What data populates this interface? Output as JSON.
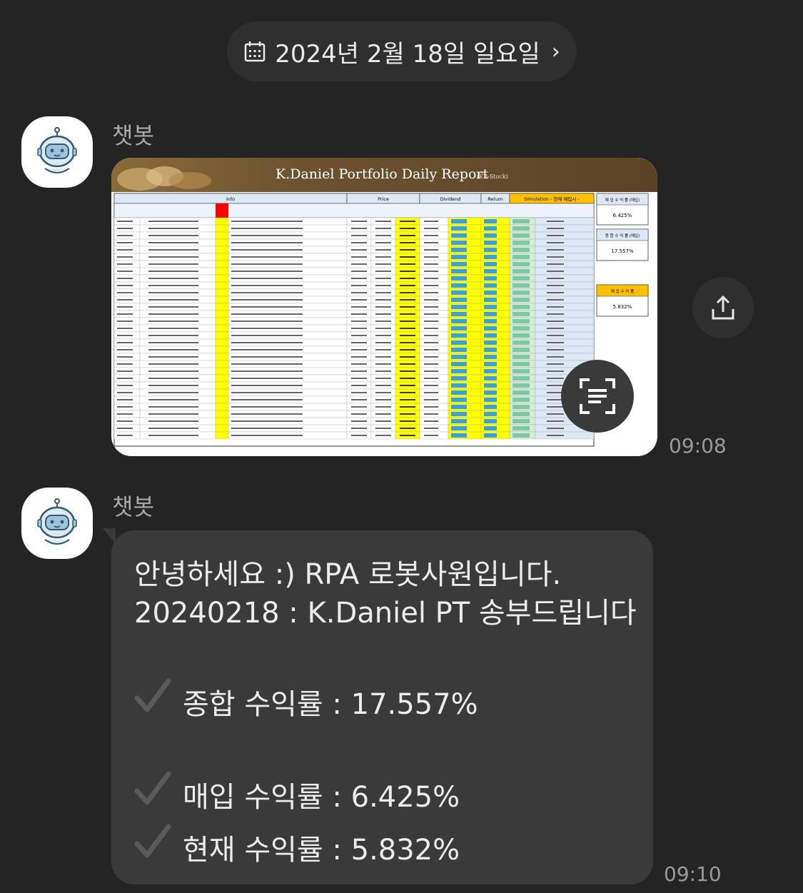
{
  "date_header": {
    "label": "2024년 2월 18일 일요일",
    "chevron": "›",
    "icon": "calendar-icon"
  },
  "messages": [
    {
      "sender": "챗봇",
      "type": "image",
      "time": "09:08",
      "report": {
        "title": "K.Daniel Portfolio Daily Report",
        "subtitle": "(KR-Stock)",
        "sections": [
          "Info",
          "Price",
          "Dividend",
          "Return",
          "Simulation - 현재 매입시 -"
        ],
        "summary_boxes": [
          {
            "label": "매 입 수 익 률 (매입)",
            "value": "6.425%"
          },
          {
            "label": "종 합 수 익 률 (매입)",
            "value": "17.557%"
          },
          {
            "label": "매 입 수 익 률",
            "value": "5.832%"
          }
        ]
      }
    },
    {
      "sender": "챗봇",
      "type": "text",
      "time": "09:10",
      "lines": [
        "안녕하세요 :) RPA 로봇사원입니다.",
        "20240218 : K.Daniel PT 송부드립니다"
      ],
      "metrics": [
        {
          "label": "종합 수익률 : 17.557%"
        },
        {
          "label": "매입 수익률 : 6.425%"
        },
        {
          "label": "현재 수익률 : 5.832%"
        }
      ]
    }
  ],
  "icons": {
    "share": "share-icon",
    "scan": "text-scan-icon",
    "check": "checkmark-icon",
    "avatar": "robot-avatar-icon"
  },
  "colors": {
    "background": "#242424",
    "bubble": "#3a3a3a",
    "pill": "#2f2f2f"
  }
}
